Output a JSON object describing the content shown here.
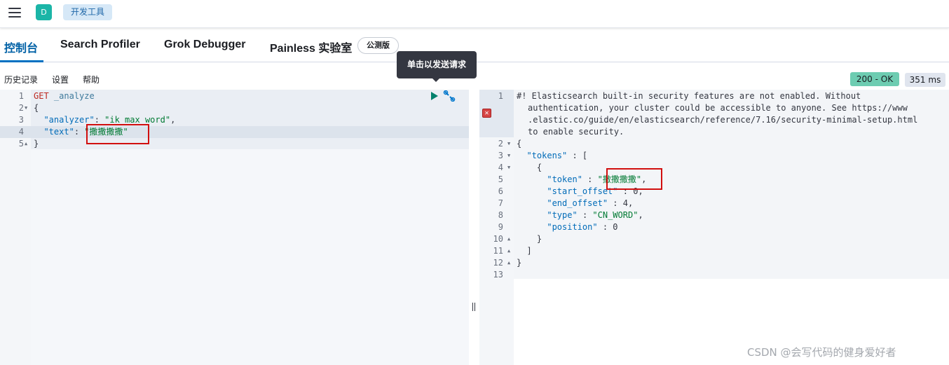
{
  "topbar": {
    "avatar_letter": "D",
    "breadcrumb": "开发工具"
  },
  "tabs": [
    {
      "label": "控制台",
      "active": true
    },
    {
      "label": "Search Profiler",
      "active": false
    },
    {
      "label": "Grok Debugger",
      "active": false
    },
    {
      "label": "Painless 实验室",
      "active": false
    }
  ],
  "beta_badge": "公测版",
  "tooltip": "单击以发送请求",
  "submenu": {
    "history": "历史记录",
    "settings": "设置",
    "help": "帮助"
  },
  "status": {
    "code": "200 - OK",
    "time": "351 ms"
  },
  "request": {
    "method": "GET",
    "path": "_analyze",
    "analyzer_key": "\"analyzer\"",
    "analyzer_value": "\"ik_max_word\"",
    "text_key": "\"text\"",
    "text_value": "\"撒撒撒撒\"",
    "line_numbers": [
      "1",
      "2",
      "3",
      "4",
      "5"
    ]
  },
  "response": {
    "warning_line1": "#! Elasticsearch built-in security features are not enabled. Without",
    "warning_line2": "authentication, your cluster could be accessible to anyone. See https://www",
    "warning_line3": ".elastic.co/guide/en/elasticsearch/reference/7.16/security-minimal-setup.html",
    "warning_line4": "to enable security.",
    "tokens_key": "\"tokens\"",
    "token_key": "\"token\"",
    "token_value_open": "\"",
    "token_value_text": "撒撒撒撒\"",
    "start_offset_key": "\"start_offset\"",
    "start_offset_value": "0",
    "end_offset_key": "\"end_offset\"",
    "end_offset_value": "4",
    "type_key": "\"type\"",
    "type_value": "\"CN_WORD\"",
    "position_key": "\"position\"",
    "position_value": "0",
    "line_numbers": [
      "1",
      "2",
      "3",
      "4",
      "5",
      "6",
      "7",
      "8",
      "9",
      "10",
      "11",
      "12",
      "13"
    ]
  },
  "watermark": "CSDN @会写代码的健身爱好者",
  "colors": {
    "accent": "#0071c2",
    "status_ok": "#6dccb1",
    "highlight": "#d10f0f"
  }
}
